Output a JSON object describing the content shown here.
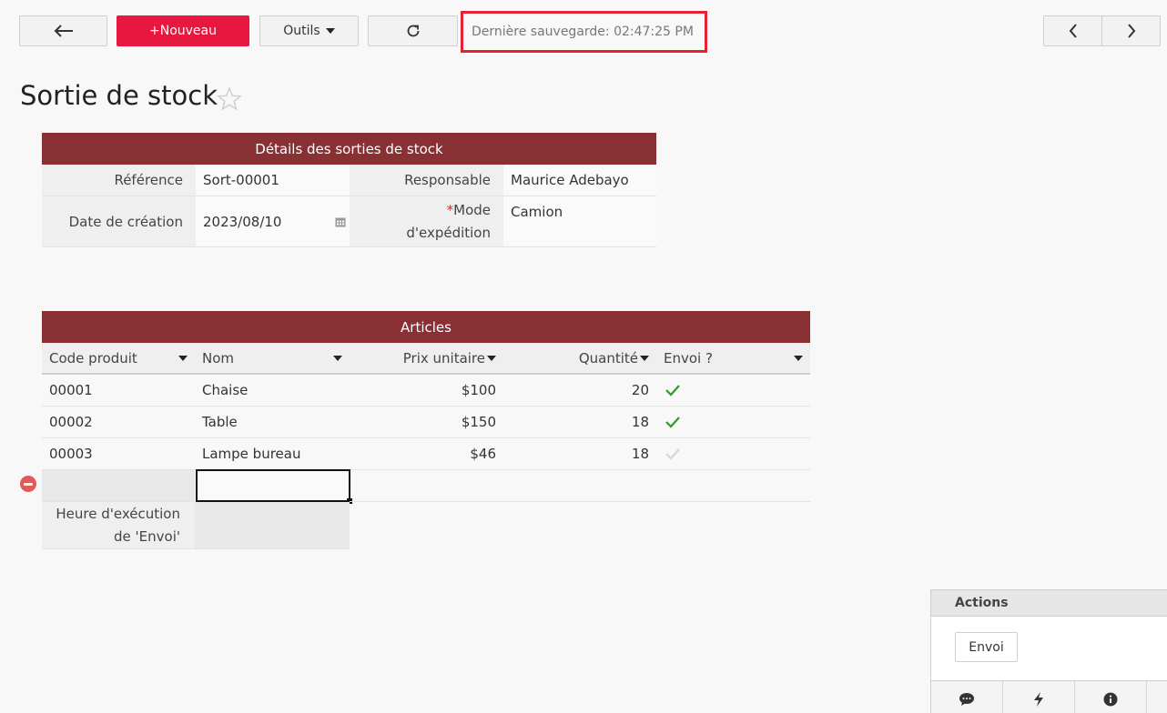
{
  "toolbar": {
    "back_icon": "arrow-left-icon",
    "new_label": "+Nouveau",
    "tools_label": "Outils",
    "refresh_icon": "refresh-icon",
    "save_status": "Dernière sauvegarde: 02:47:25 PM",
    "prev_icon": "chevron-left-icon",
    "next_icon": "chevron-right-icon"
  },
  "page": {
    "title": "Sortie de stock"
  },
  "details": {
    "header": "Détails des sorties de stock",
    "reference_label": "Référence",
    "reference_value": "Sort-00001",
    "responsable_label": "Responsable",
    "responsable_value": "Maurice Adebayo",
    "date_label": "Date de création",
    "date_value": "2023/08/10",
    "mode_required": "*",
    "mode_label_line1": "Mode",
    "mode_label_line2": "d'expédition",
    "mode_value": "Camion"
  },
  "articles": {
    "header": "Articles",
    "columns": [
      "Code produit",
      "Nom",
      "Prix unitaire",
      "Quantité",
      "Envoi ?"
    ],
    "rows": [
      {
        "code": "00001",
        "nom": "Chaise",
        "prix": "$100",
        "quantite": "20",
        "envoi": true
      },
      {
        "code": "00002",
        "nom": "Table",
        "prix": "$150",
        "quantite": "18",
        "envoi": true
      },
      {
        "code": "00003",
        "nom": "Lampe bureau",
        "prix": "$46",
        "quantite": "18",
        "envoi": false
      }
    ],
    "exec_label_line1": "Heure d'exécution",
    "exec_label_line2": "de 'Envoi'"
  },
  "actions": {
    "title": "Actions",
    "envoi_label": "Envoi",
    "footer_icons": [
      "comment-icon",
      "bolt-icon",
      "info-icon"
    ]
  },
  "colors": {
    "accent": "#e8173f",
    "section_header": "#883034",
    "highlight_border": "#e32232",
    "check_active": "#2a9d2a",
    "check_inactive": "#cfcfcf"
  }
}
